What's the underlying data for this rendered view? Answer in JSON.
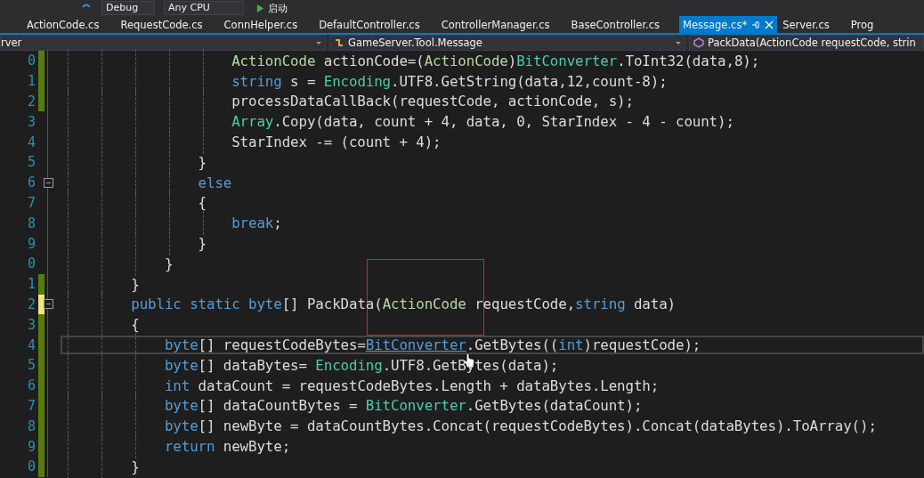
{
  "toolbar": {
    "configuration": "Debug",
    "platform": "Any CPU",
    "start_label": "启动"
  },
  "tabs": [
    {
      "label": "ActionCode.cs",
      "selected": false
    },
    {
      "label": "RequestCode.cs",
      "selected": false
    },
    {
      "label": "ConnHelper.cs",
      "selected": false
    },
    {
      "label": "DefaultController.cs",
      "selected": false
    },
    {
      "label": "ControllerManager.cs",
      "selected": false
    },
    {
      "label": "BaseController.cs",
      "selected": false
    },
    {
      "label": "Message.cs*",
      "selected": true
    },
    {
      "label": "Server.cs",
      "selected": false
    },
    {
      "label": "Prog",
      "selected": false
    }
  ],
  "nav_bar": {
    "project": "rver",
    "class": "GameServer.Tool.Message",
    "member": "PackData(ActionCode requestCode, strin"
  },
  "code_lines": [
    {
      "number": "0",
      "modified": true,
      "saved": true,
      "fold": false,
      "current": false,
      "tokens": [
        {
          "kind": "enum",
          "text": "                    ActionCode"
        },
        {
          "kind": "plain",
          "text": " actionCode=("
        },
        {
          "kind": "enum",
          "text": "ActionCode"
        },
        {
          "kind": "plain",
          "text": ")"
        },
        {
          "kind": "type",
          "text": "BitConverter"
        },
        {
          "kind": "plain",
          "text": ".ToInt32(data,8);"
        }
      ]
    },
    {
      "number": "1",
      "modified": true,
      "saved": true,
      "fold": false,
      "current": false,
      "tokens": [
        {
          "kind": "keyword",
          "text": "                    string"
        },
        {
          "kind": "plain",
          "text": " s = "
        },
        {
          "kind": "type",
          "text": "Encoding"
        },
        {
          "kind": "plain",
          "text": ".UTF8.GetString(data,12,count-8);"
        }
      ]
    },
    {
      "number": "2",
      "modified": true,
      "saved": true,
      "fold": false,
      "current": false,
      "tokens": [
        {
          "kind": "plain",
          "text": "                    processDataCallBack(requestCode, actionCode, s);"
        }
      ]
    },
    {
      "number": "3",
      "modified": false,
      "fold": false,
      "current": false,
      "tokens": [
        {
          "kind": "type",
          "text": "                    Array"
        },
        {
          "kind": "plain",
          "text": ".Copy(data, count + 4, data, 0, StarIndex - 4 - count);"
        }
      ]
    },
    {
      "number": "4",
      "modified": false,
      "fold": false,
      "current": false,
      "tokens": [
        {
          "kind": "plain",
          "text": "                    StarIndex -= (count + 4);"
        }
      ]
    },
    {
      "number": "5",
      "modified": false,
      "fold": false,
      "current": false,
      "tokens": [
        {
          "kind": "plain",
          "text": "                }"
        }
      ]
    },
    {
      "number": "6",
      "modified": false,
      "fold": true,
      "current": false,
      "tokens": [
        {
          "kind": "keyword",
          "text": "                else"
        }
      ]
    },
    {
      "number": "7",
      "modified": false,
      "fold": false,
      "current": false,
      "tokens": [
        {
          "kind": "plain",
          "text": "                {"
        }
      ]
    },
    {
      "number": "8",
      "modified": false,
      "fold": false,
      "current": false,
      "tokens": [
        {
          "kind": "keyword",
          "text": "                    break"
        },
        {
          "kind": "plain",
          "text": ";"
        }
      ]
    },
    {
      "number": "9",
      "modified": false,
      "fold": false,
      "current": false,
      "tokens": [
        {
          "kind": "plain",
          "text": "                }"
        }
      ]
    },
    {
      "number": "0",
      "modified": false,
      "fold": false,
      "current": false,
      "tokens": [
        {
          "kind": "plain",
          "text": "            }"
        }
      ]
    },
    {
      "number": "1",
      "modified": true,
      "saved": true,
      "fold": false,
      "current": false,
      "tokens": [
        {
          "kind": "plain",
          "text": "        }"
        }
      ]
    },
    {
      "number": "2",
      "modified": true,
      "saved": false,
      "fold": true,
      "current": false,
      "tokens": [
        {
          "kind": "keyword",
          "text": "        public static byte"
        },
        {
          "kind": "plain",
          "text": "[] PackData("
        },
        {
          "kind": "enum",
          "text": "ActionCode"
        },
        {
          "kind": "plain",
          "text": " requestCode,"
        },
        {
          "kind": "keyword",
          "text": "string"
        },
        {
          "kind": "plain",
          "text": " data)"
        }
      ]
    },
    {
      "number": "3",
      "modified": true,
      "saved": true,
      "fold": false,
      "current": false,
      "tokens": [
        {
          "kind": "plain",
          "text": "        {"
        }
      ]
    },
    {
      "number": "4",
      "modified": true,
      "saved": true,
      "fold": false,
      "current": true,
      "tokens": [
        {
          "kind": "keyword",
          "text": "            byte"
        },
        {
          "kind": "plain",
          "text": "[] requestCodeBytes="
        },
        {
          "kind": "link",
          "text": "BitConverter"
        },
        {
          "kind": "plain",
          "text": ".GetBytes(("
        },
        {
          "kind": "keyword",
          "text": "int"
        },
        {
          "kind": "plain",
          "text": ")requestCode);"
        }
      ]
    },
    {
      "number": "5",
      "modified": true,
      "saved": true,
      "fold": false,
      "current": false,
      "tokens": [
        {
          "kind": "keyword",
          "text": "            byte"
        },
        {
          "kind": "plain",
          "text": "[] dataBytes= "
        },
        {
          "kind": "type",
          "text": "Encoding"
        },
        {
          "kind": "plain",
          "text": ".UTF8.GetBytes(data);"
        }
      ]
    },
    {
      "number": "6",
      "modified": true,
      "saved": true,
      "fold": false,
      "current": false,
      "tokens": [
        {
          "kind": "keyword",
          "text": "            int"
        },
        {
          "kind": "plain",
          "text": " dataCount = requestCodeBytes.Length + dataBytes.Length;"
        }
      ]
    },
    {
      "number": "7",
      "modified": true,
      "saved": true,
      "fold": false,
      "current": false,
      "tokens": [
        {
          "kind": "keyword",
          "text": "            byte"
        },
        {
          "kind": "plain",
          "text": "[] dataCountBytes = "
        },
        {
          "kind": "type",
          "text": "BitConverter"
        },
        {
          "kind": "plain",
          "text": ".GetBytes(dataCount);"
        }
      ]
    },
    {
      "number": "8",
      "modified": true,
      "saved": true,
      "fold": false,
      "current": false,
      "tokens": [
        {
          "kind": "keyword",
          "text": "            byte"
        },
        {
          "kind": "plain",
          "text": "[] newByte = dataCountBytes.Concat(requestCodeBytes).Concat(dataBytes).ToArray();"
        }
      ]
    },
    {
      "number": "9",
      "modified": true,
      "saved": true,
      "fold": false,
      "current": false,
      "tokens": [
        {
          "kind": "keyword",
          "text": "            return"
        },
        {
          "kind": "plain",
          "text": " newByte;"
        }
      ]
    },
    {
      "number": "0",
      "modified": true,
      "saved": true,
      "fold": false,
      "current": false,
      "tokens": [
        {
          "kind": "plain",
          "text": "        }"
        }
      ]
    }
  ]
}
